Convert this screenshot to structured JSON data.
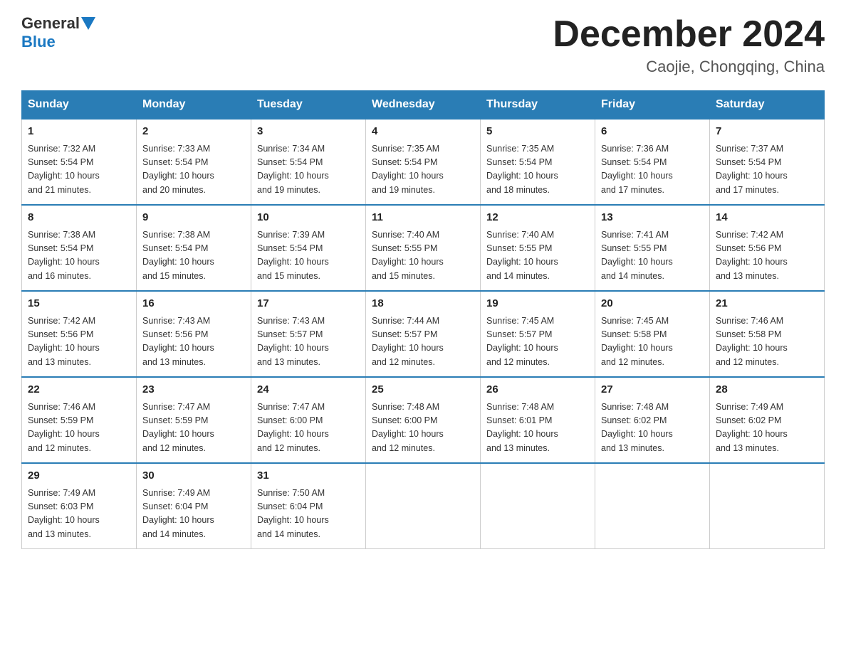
{
  "header": {
    "logo": {
      "general": "General",
      "blue": "Blue"
    },
    "title": "December 2024",
    "location": "Caojie, Chongqing, China"
  },
  "calendar": {
    "days_of_week": [
      "Sunday",
      "Monday",
      "Tuesday",
      "Wednesday",
      "Thursday",
      "Friday",
      "Saturday"
    ],
    "weeks": [
      [
        {
          "day": "1",
          "info": "Sunrise: 7:32 AM\nSunset: 5:54 PM\nDaylight: 10 hours\nand 21 minutes."
        },
        {
          "day": "2",
          "info": "Sunrise: 7:33 AM\nSunset: 5:54 PM\nDaylight: 10 hours\nand 20 minutes."
        },
        {
          "day": "3",
          "info": "Sunrise: 7:34 AM\nSunset: 5:54 PM\nDaylight: 10 hours\nand 19 minutes."
        },
        {
          "day": "4",
          "info": "Sunrise: 7:35 AM\nSunset: 5:54 PM\nDaylight: 10 hours\nand 19 minutes."
        },
        {
          "day": "5",
          "info": "Sunrise: 7:35 AM\nSunset: 5:54 PM\nDaylight: 10 hours\nand 18 minutes."
        },
        {
          "day": "6",
          "info": "Sunrise: 7:36 AM\nSunset: 5:54 PM\nDaylight: 10 hours\nand 17 minutes."
        },
        {
          "day": "7",
          "info": "Sunrise: 7:37 AM\nSunset: 5:54 PM\nDaylight: 10 hours\nand 17 minutes."
        }
      ],
      [
        {
          "day": "8",
          "info": "Sunrise: 7:38 AM\nSunset: 5:54 PM\nDaylight: 10 hours\nand 16 minutes."
        },
        {
          "day": "9",
          "info": "Sunrise: 7:38 AM\nSunset: 5:54 PM\nDaylight: 10 hours\nand 15 minutes."
        },
        {
          "day": "10",
          "info": "Sunrise: 7:39 AM\nSunset: 5:54 PM\nDaylight: 10 hours\nand 15 minutes."
        },
        {
          "day": "11",
          "info": "Sunrise: 7:40 AM\nSunset: 5:55 PM\nDaylight: 10 hours\nand 15 minutes."
        },
        {
          "day": "12",
          "info": "Sunrise: 7:40 AM\nSunset: 5:55 PM\nDaylight: 10 hours\nand 14 minutes."
        },
        {
          "day": "13",
          "info": "Sunrise: 7:41 AM\nSunset: 5:55 PM\nDaylight: 10 hours\nand 14 minutes."
        },
        {
          "day": "14",
          "info": "Sunrise: 7:42 AM\nSunset: 5:56 PM\nDaylight: 10 hours\nand 13 minutes."
        }
      ],
      [
        {
          "day": "15",
          "info": "Sunrise: 7:42 AM\nSunset: 5:56 PM\nDaylight: 10 hours\nand 13 minutes."
        },
        {
          "day": "16",
          "info": "Sunrise: 7:43 AM\nSunset: 5:56 PM\nDaylight: 10 hours\nand 13 minutes."
        },
        {
          "day": "17",
          "info": "Sunrise: 7:43 AM\nSunset: 5:57 PM\nDaylight: 10 hours\nand 13 minutes."
        },
        {
          "day": "18",
          "info": "Sunrise: 7:44 AM\nSunset: 5:57 PM\nDaylight: 10 hours\nand 12 minutes."
        },
        {
          "day": "19",
          "info": "Sunrise: 7:45 AM\nSunset: 5:57 PM\nDaylight: 10 hours\nand 12 minutes."
        },
        {
          "day": "20",
          "info": "Sunrise: 7:45 AM\nSunset: 5:58 PM\nDaylight: 10 hours\nand 12 minutes."
        },
        {
          "day": "21",
          "info": "Sunrise: 7:46 AM\nSunset: 5:58 PM\nDaylight: 10 hours\nand 12 minutes."
        }
      ],
      [
        {
          "day": "22",
          "info": "Sunrise: 7:46 AM\nSunset: 5:59 PM\nDaylight: 10 hours\nand 12 minutes."
        },
        {
          "day": "23",
          "info": "Sunrise: 7:47 AM\nSunset: 5:59 PM\nDaylight: 10 hours\nand 12 minutes."
        },
        {
          "day": "24",
          "info": "Sunrise: 7:47 AM\nSunset: 6:00 PM\nDaylight: 10 hours\nand 12 minutes."
        },
        {
          "day": "25",
          "info": "Sunrise: 7:48 AM\nSunset: 6:00 PM\nDaylight: 10 hours\nand 12 minutes."
        },
        {
          "day": "26",
          "info": "Sunrise: 7:48 AM\nSunset: 6:01 PM\nDaylight: 10 hours\nand 13 minutes."
        },
        {
          "day": "27",
          "info": "Sunrise: 7:48 AM\nSunset: 6:02 PM\nDaylight: 10 hours\nand 13 minutes."
        },
        {
          "day": "28",
          "info": "Sunrise: 7:49 AM\nSunset: 6:02 PM\nDaylight: 10 hours\nand 13 minutes."
        }
      ],
      [
        {
          "day": "29",
          "info": "Sunrise: 7:49 AM\nSunset: 6:03 PM\nDaylight: 10 hours\nand 13 minutes."
        },
        {
          "day": "30",
          "info": "Sunrise: 7:49 AM\nSunset: 6:04 PM\nDaylight: 10 hours\nand 14 minutes."
        },
        {
          "day": "31",
          "info": "Sunrise: 7:50 AM\nSunset: 6:04 PM\nDaylight: 10 hours\nand 14 minutes."
        },
        null,
        null,
        null,
        null
      ]
    ]
  }
}
